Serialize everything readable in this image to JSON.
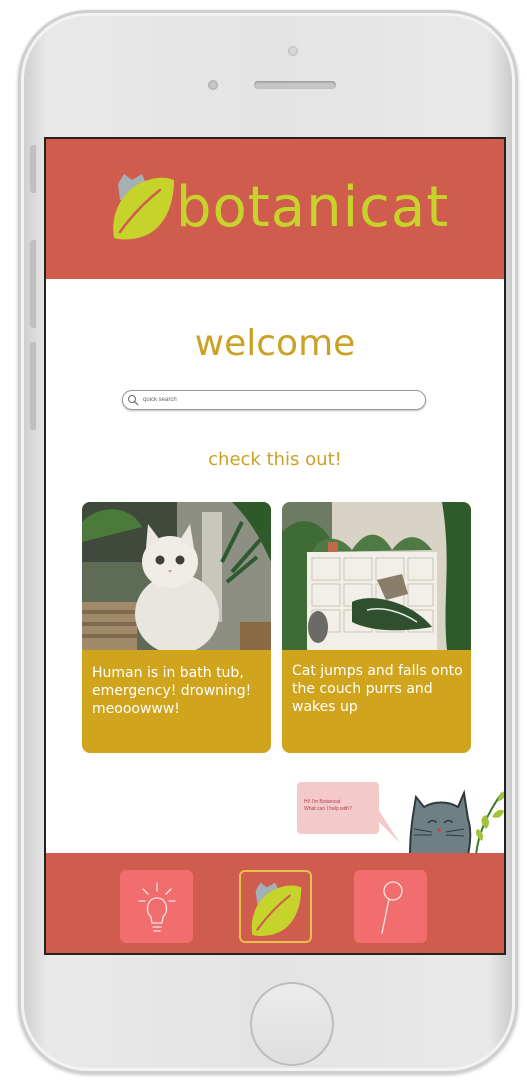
{
  "app": {
    "brand": "botanicat",
    "welcome": "welcome"
  },
  "search": {
    "placeholder": "quick search"
  },
  "feed": {
    "heading": "check this out!",
    "cards": [
      {
        "caption": "Human is in bath tub, emergency! drowning! meooowww!"
      },
      {
        "caption": "Cat jumps and falls onto the couch purrs and wakes up"
      }
    ]
  },
  "assistant": {
    "line1": "Hi! I'm Botanicat.",
    "line2": "What can I help with?"
  },
  "nav": {
    "items": [
      {
        "icon": "lightbulb-icon"
      },
      {
        "icon": "leaf-logo-icon"
      },
      {
        "icon": "search-icon"
      }
    ]
  },
  "colors": {
    "header": "#cf5c4d",
    "brand_text": "#c6d32a",
    "accent_gold": "#c9a226",
    "card": "#d0a41c",
    "nav_button": "#f26e6e"
  }
}
